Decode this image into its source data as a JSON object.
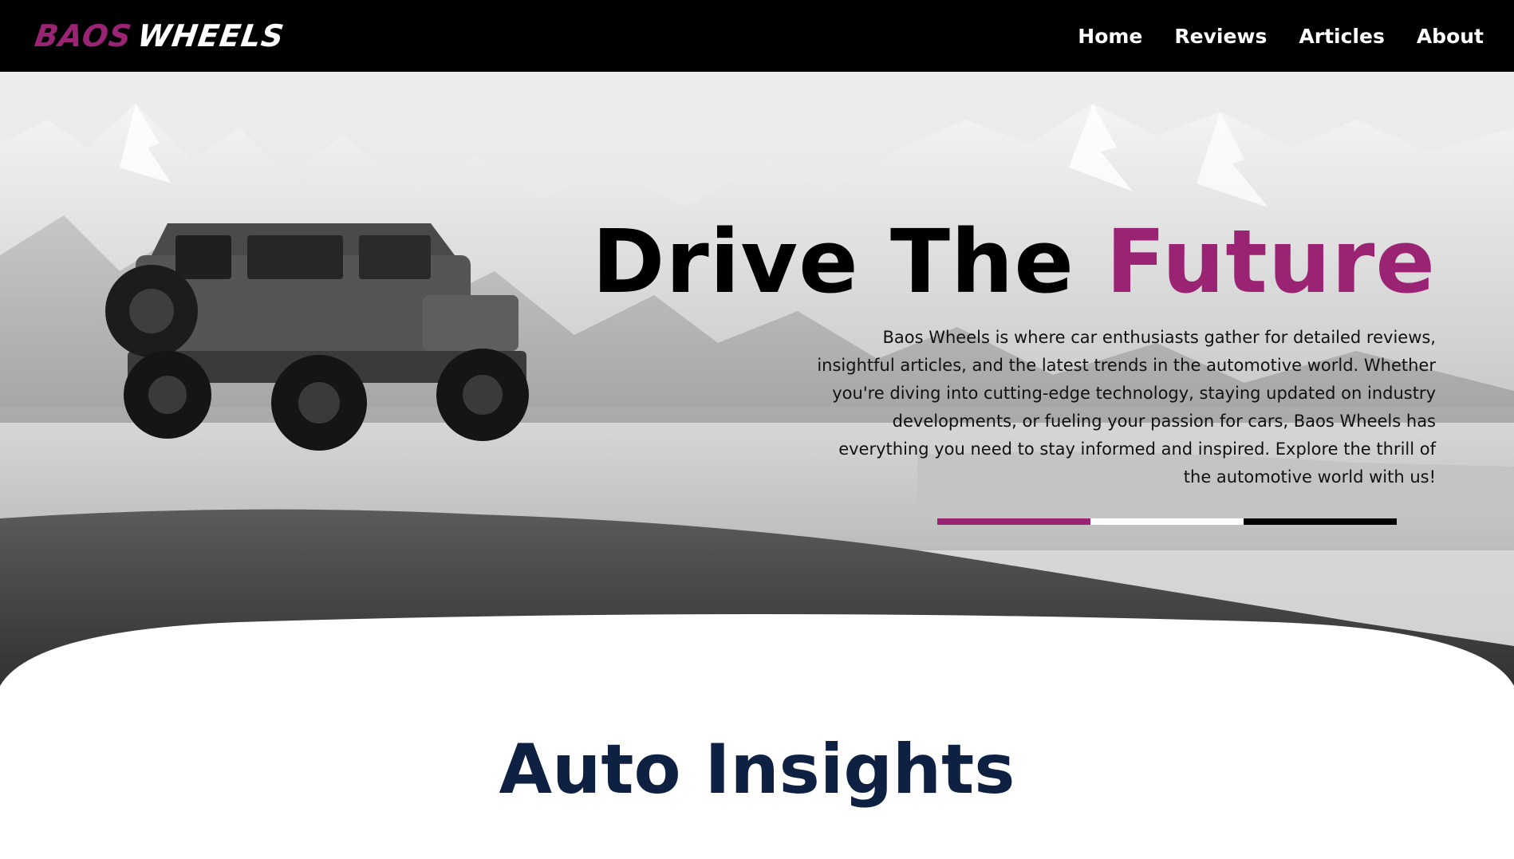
{
  "header": {
    "logo": {
      "part1": "BAOS",
      "part2": "WHEELS"
    },
    "nav": [
      {
        "label": "Home"
      },
      {
        "label": "Reviews"
      },
      {
        "label": "Articles"
      },
      {
        "label": "About"
      }
    ]
  },
  "hero": {
    "title_main": "Drive The",
    "title_accent": "Future",
    "description": "Baos Wheels is where car enthusiasts gather for detailed reviews, insightful articles, and the latest trends in the automotive world. Whether you're diving into cutting-edge technology, staying updated on industry developments, or fueling your passion for cars, Baos Wheels has everything you need to stay informed and inspired. Explore the thrill of the automotive world with us!",
    "background_image": "black-and-white mountain landscape with an off-road 4x4 vehicle parked on a grassy ridge",
    "divider_colors": [
      "#9b2374",
      "#ffffff",
      "#000000"
    ]
  },
  "colors": {
    "brand_accent": "#9b2374",
    "nav_background": "#000000",
    "heading_navy": "#0f2142"
  },
  "section": {
    "title": "Auto Insights"
  }
}
